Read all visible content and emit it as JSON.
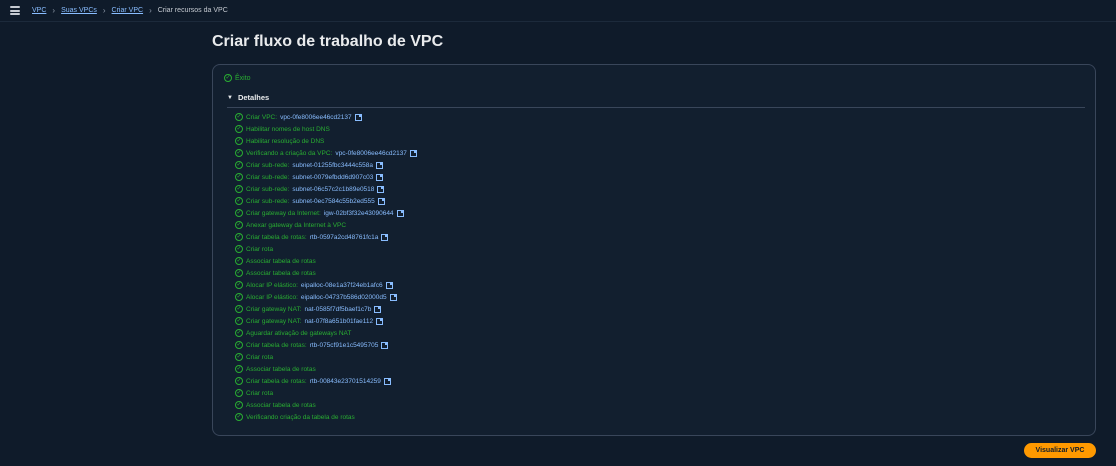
{
  "breadcrumb": {
    "items": [
      "VPC",
      "Suas VPCs",
      "Criar VPC"
    ],
    "current": "Criar recursos da VPC"
  },
  "page": {
    "title": "Criar fluxo de trabalho de VPC"
  },
  "status": {
    "text": "Êxito",
    "color": "#29ad32"
  },
  "details": {
    "heading": "Detalhes",
    "steps": [
      {
        "label": "Criar VPC:",
        "link": "vpc-0fe8006ee46cd2137"
      },
      {
        "label": "Habilitar nomes de host DNS"
      },
      {
        "label": "Habilitar resolução de DNS"
      },
      {
        "label": "Verificando a criação da VPC:",
        "link": "vpc-0fe8006ee46cd2137"
      },
      {
        "label": "Criar sub-rede:",
        "link": "subnet-01255fbc3444c558a"
      },
      {
        "label": "Criar sub-rede:",
        "link": "subnet-0079efbdd6d907c03"
      },
      {
        "label": "Criar sub-rede:",
        "link": "subnet-06c57c2c1b89e0518"
      },
      {
        "label": "Criar sub-rede:",
        "link": "subnet-0ec7584c55b2ed555"
      },
      {
        "label": "Criar gateway da Internet:",
        "link": "igw-02bf3f32e43090644"
      },
      {
        "label": "Anexar gateway da Internet à VPC"
      },
      {
        "label": "Criar tabela de rotas:",
        "link": "rtb-0597a2cd48761fc1a"
      },
      {
        "label": "Criar rota"
      },
      {
        "label": "Associar tabela de rotas"
      },
      {
        "label": "Associar tabela de rotas"
      },
      {
        "label": "Alocar IP elástico:",
        "link": "eipalloc-08e1a37f24eb1afc6"
      },
      {
        "label": "Alocar IP elástico:",
        "link": "eipalloc-04737b586d02000d5"
      },
      {
        "label": "Criar gateway NAT:",
        "link": "nat-0585f7df5baef1c7b"
      },
      {
        "label": "Criar gateway NAT:",
        "link": "nat-07f8a651b01fae112"
      },
      {
        "label": "Aguardar ativação de gateways NAT"
      },
      {
        "label": "Criar tabela de rotas:",
        "link": "rtb-075cf91e1c5495705"
      },
      {
        "label": "Criar rota"
      },
      {
        "label": "Associar tabela de rotas"
      },
      {
        "label": "Criar tabela de rotas:",
        "link": "rtb-00843e23701514259"
      },
      {
        "label": "Criar rota"
      },
      {
        "label": "Associar tabela de rotas"
      },
      {
        "label": "Verificando criação da tabela de rotas"
      }
    ]
  },
  "actions": {
    "view_vpc": "Visualizar VPC"
  },
  "colors": {
    "accent": "#ff9900",
    "link": "#89bdff",
    "success": "#29ad32",
    "background": "#0f1b2a"
  }
}
